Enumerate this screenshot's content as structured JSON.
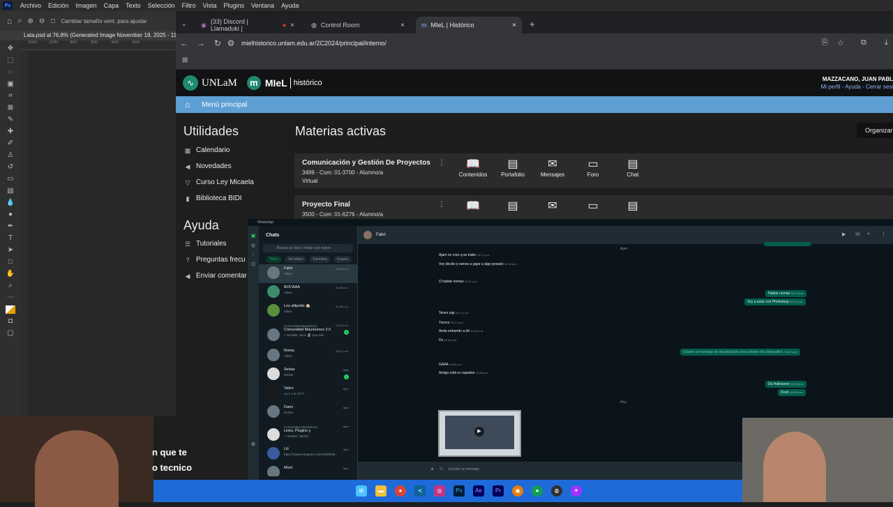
{
  "photoshop": {
    "menu": [
      "Archivo",
      "Edición",
      "Imagen",
      "Capa",
      "Texto",
      "Selección",
      "Filtro",
      "Vista",
      "Plugins",
      "Ventana",
      "Ayuda"
    ],
    "options_text": "Cambiar tamaño vent. para ajustar",
    "doc_tab": "Lata.psd al 76,8% (Generated Image November 18, 2025 - 11_1",
    "ruler": [
      "1050",
      "1000",
      "950",
      "900",
      "850",
      "800"
    ]
  },
  "browser": {
    "tabs": [
      {
        "label": "(33) Discord | Llamaduki |"
      },
      {
        "label": "Control Room"
      },
      {
        "label": "MIeL | Histórico"
      }
    ],
    "url": "mielhistorico.unlam.edu.ar/2C2024/principal/interno/"
  },
  "miel": {
    "unlam_label": "UNLaM",
    "miel_label": "MIeL",
    "historico_label": "histórico",
    "user_name": "MAZZACANO, JUAN PABL",
    "user_links": "Mi perfil - Ayuda - Cerrar sesi",
    "nav_label": "Menú principal",
    "utilidades_title": "Utilidades",
    "utilidades": [
      {
        "label": "Calendario",
        "icon": "calendar-icon"
      },
      {
        "label": "Novedades",
        "icon": "megaphone-icon"
      },
      {
        "label": "Curso Ley Micaela",
        "icon": "filter-icon"
      },
      {
        "label": "Biblioteca BIDI",
        "icon": "book-icon"
      }
    ],
    "ayuda_title": "Ayuda",
    "ayuda": [
      {
        "label": "Tutoriales",
        "icon": "list-icon"
      },
      {
        "label": "Preguntas frecu",
        "icon": "help-icon"
      },
      {
        "label": "Enviar comentar",
        "icon": "megaphone-icon"
      }
    ],
    "materias_title": "Materias activas",
    "organizar_label": "Organizar",
    "courses": [
      {
        "name": "Comunicación y Gestión De Proyectos",
        "meta1": "3499 - Com: 01-3700 - Alumno/a",
        "meta2": "Virtual"
      },
      {
        "name": "Proyecto Final",
        "meta1": "3500 - Com: 01-6276 - Alumno/a",
        "meta2": ""
      }
    ],
    "actions": [
      "Contenidos",
      "Portafolio",
      "Mensajes",
      "Foro",
      "Chat"
    ]
  },
  "whatsapp": {
    "title": "WhatsApp",
    "chats_title": "Chats",
    "search_placeholder": "Buscar un chat o iniciar uno nuevo",
    "filters": [
      "Todos",
      "No leídos",
      "Favoritos",
      "Grupos"
    ],
    "chats": [
      {
        "name": "Fabri",
        "preview": "Video",
        "time": "12:49 p.m."
      },
      {
        "name": "BOCAAA",
        "preview": "Video",
        "time": "12:48 p.m."
      },
      {
        "name": "Los sifipollis 🏠",
        "preview": "Video",
        "time": "12:48 p.m."
      },
      {
        "name": "Comunidad Mauriesnos 2.0",
        "preview": "~ DavidM. Jane: 🗿 que edit",
        "time": "12:23 p.m.",
        "badge": "2",
        "group": "Comunidad Mauriesnos"
      },
      {
        "name": "Roma",
        "preview": "Video",
        "time": "12:07 p.m."
      },
      {
        "name": "Sebas",
        "preview": "Sticker",
        "time": "Ayer",
        "badge": "1"
      },
      {
        "name": "Valen",
        "preview": "La 1 o la 2???",
        "time": "Ayer"
      },
      {
        "name": "Dami",
        "preview": "Dosha",
        "time": "Ayer"
      },
      {
        "name": "Links, Plugins y",
        "preview": "~ Heavier: Sticker",
        "time": "Ayer",
        "group": "Comunidad Mauriesnos"
      },
      {
        "name": "Lili",
        "preview": "https://www.instagram.com/reel/DM0...",
        "time": "Ayer"
      },
      {
        "name": "Moni",
        "preview": "",
        "time": "Ayer"
      }
    ],
    "contact": "Fabri",
    "date_sep_1": "Ayer",
    "messages_in": [
      {
        "text": "Ajam no creo q se trabe",
        "time": "10:17 p.m."
      },
      {
        "text": "Voy decile q vamos a jugar a algo pesado",
        "time": "10:18 p.m."
      },
      {
        "text": "O hablar nomas",
        "time": "10:17 p.m."
      },
      {
        "text": "Tenes yap",
        "time": "10:17 p.m."
      },
      {
        "text": "Trenco",
        "time": "10:17 p.m."
      },
      {
        "text": "Anda entrando a dd",
        "time": "10:18 p.m."
      },
      {
        "text": "Ds",
        "time": "10:18 p.m."
      },
      {
        "text": "GAAA",
        "time": "10:51 p.m."
      },
      {
        "text": "Amigo está re copadoo",
        "time": "10:52 p.m."
      }
    ],
    "messages_out": [
      {
        "text": "Hablar nomas",
        "time": "10:17 p.m."
      },
      {
        "text": "Voy a estar con Photoshop",
        "time": "10:17 p.m."
      },
      {
        "text": "Usaste un mensaje de visualización única desde otro dispositivo.",
        "time": "10:27 p.m."
      },
      {
        "text": "Da Halloween",
        "time": "10:52 p.m."
      },
      {
        "text": "Dosh",
        "time": "10:52 p.m."
      }
    ],
    "date_sep_2": "Hoy",
    "input_placeholder": "Escribe un mensaje"
  },
  "subtitles": {
    "line1": "n que te",
    "line2": "o tecnico"
  },
  "taskbar": {
    "apps": [
      "windows-icon",
      "file-explorer-icon",
      "chrome-icon",
      "vscode-icon",
      "instagram-icon",
      "photoshop-icon",
      "after-effects-icon",
      "premiere-icon",
      "blender-icon",
      "chrome-icon",
      "obs-icon",
      "messenger-icon"
    ]
  }
}
